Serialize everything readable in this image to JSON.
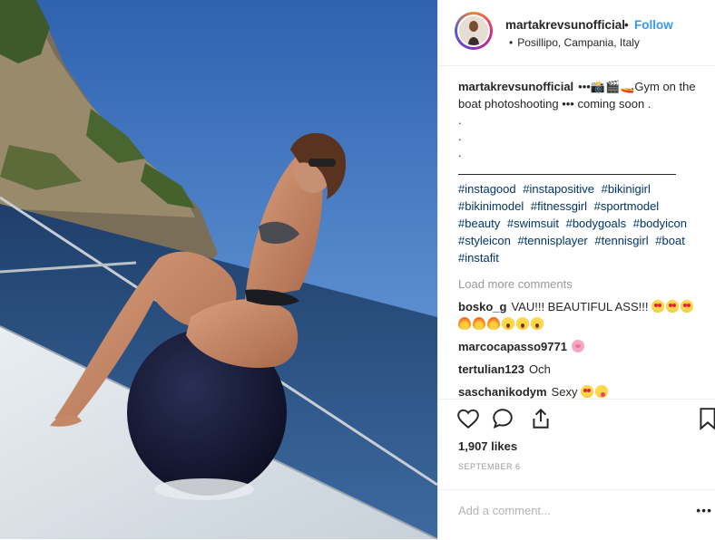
{
  "post": {
    "header": {
      "username": "martakrevsunofficial",
      "separator": "•",
      "follow_label": "Follow",
      "location_bullet": "•",
      "location": "Posillipo, Campania, Italy"
    },
    "caption": {
      "username": "martakrevsunofficial",
      "text_line1": "•••📸🎬🚤Gym on the boat photoshooting ••• coming soon .",
      "dot1": ".",
      "dot2": ".",
      "dot3": ".",
      "hashtags": [
        "#instagood",
        "#instapositive",
        "#bikinigirl",
        "#bikinimodel",
        "#fitnessgirl",
        "#sportmodel",
        "#beauty",
        "#swimsuit",
        "#bodygoals",
        "#bodyicon",
        "#styleicon",
        "#tennisplayer",
        "#tennisgirl",
        "#boat",
        "#instafit"
      ]
    },
    "load_more": "Load more comments",
    "comments": [
      {
        "user": "bosko_g",
        "text": "VAU!!! BEAUTIFUL ASS!!!"
      },
      {
        "user": "marcocapasso9771",
        "text": ""
      },
      {
        "user": "tertulian123",
        "text": "Och"
      },
      {
        "user": "saschanikodym",
        "text": "Sexy"
      }
    ],
    "icons": {
      "like": "heart-icon",
      "comment": "comment-icon",
      "share": "share-icon",
      "save": "bookmark-icon"
    },
    "likes": "1,907 likes",
    "date": "SEPTEMBER 6",
    "comment_placeholder": "Add a comment...",
    "more_options": "•••"
  },
  "colors": {
    "link_blue": "#3897f0",
    "hashtag": "#003569",
    "muted": "#999999",
    "text": "#262626"
  }
}
